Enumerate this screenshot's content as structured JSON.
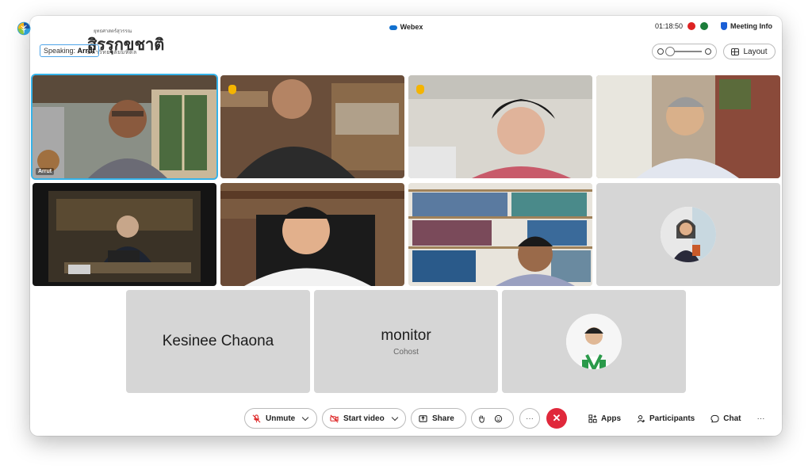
{
  "logo": {
    "name": "สิรรุกขชาติ",
    "top_text": "ยุทธศาสตร์สุวรรณ",
    "sub_text": "มหาวิทยาลัยมหิดล"
  },
  "window": {
    "title": "Webex"
  },
  "status": {
    "timer": "01:18:50",
    "meeting_info": "Meeting Info"
  },
  "speaking": {
    "label": "Speaking:",
    "name": "Arrut"
  },
  "layout_button": "Layout",
  "tiles": [
    {
      "name": "Arrut"
    },
    {
      "name": "Kesinee Chaona"
    },
    {
      "name": "monitor",
      "role": "Cohost"
    }
  ],
  "toolbar": {
    "unmute": "Unmute",
    "start_video": "Start video",
    "share": "Share",
    "more": "···",
    "apps": "Apps",
    "participants": "Participants",
    "chat": "Chat",
    "overflow": "···"
  },
  "colors": {
    "accent": "#35b2e8",
    "end_call": "#e0283b",
    "recording": "#dd2222"
  }
}
